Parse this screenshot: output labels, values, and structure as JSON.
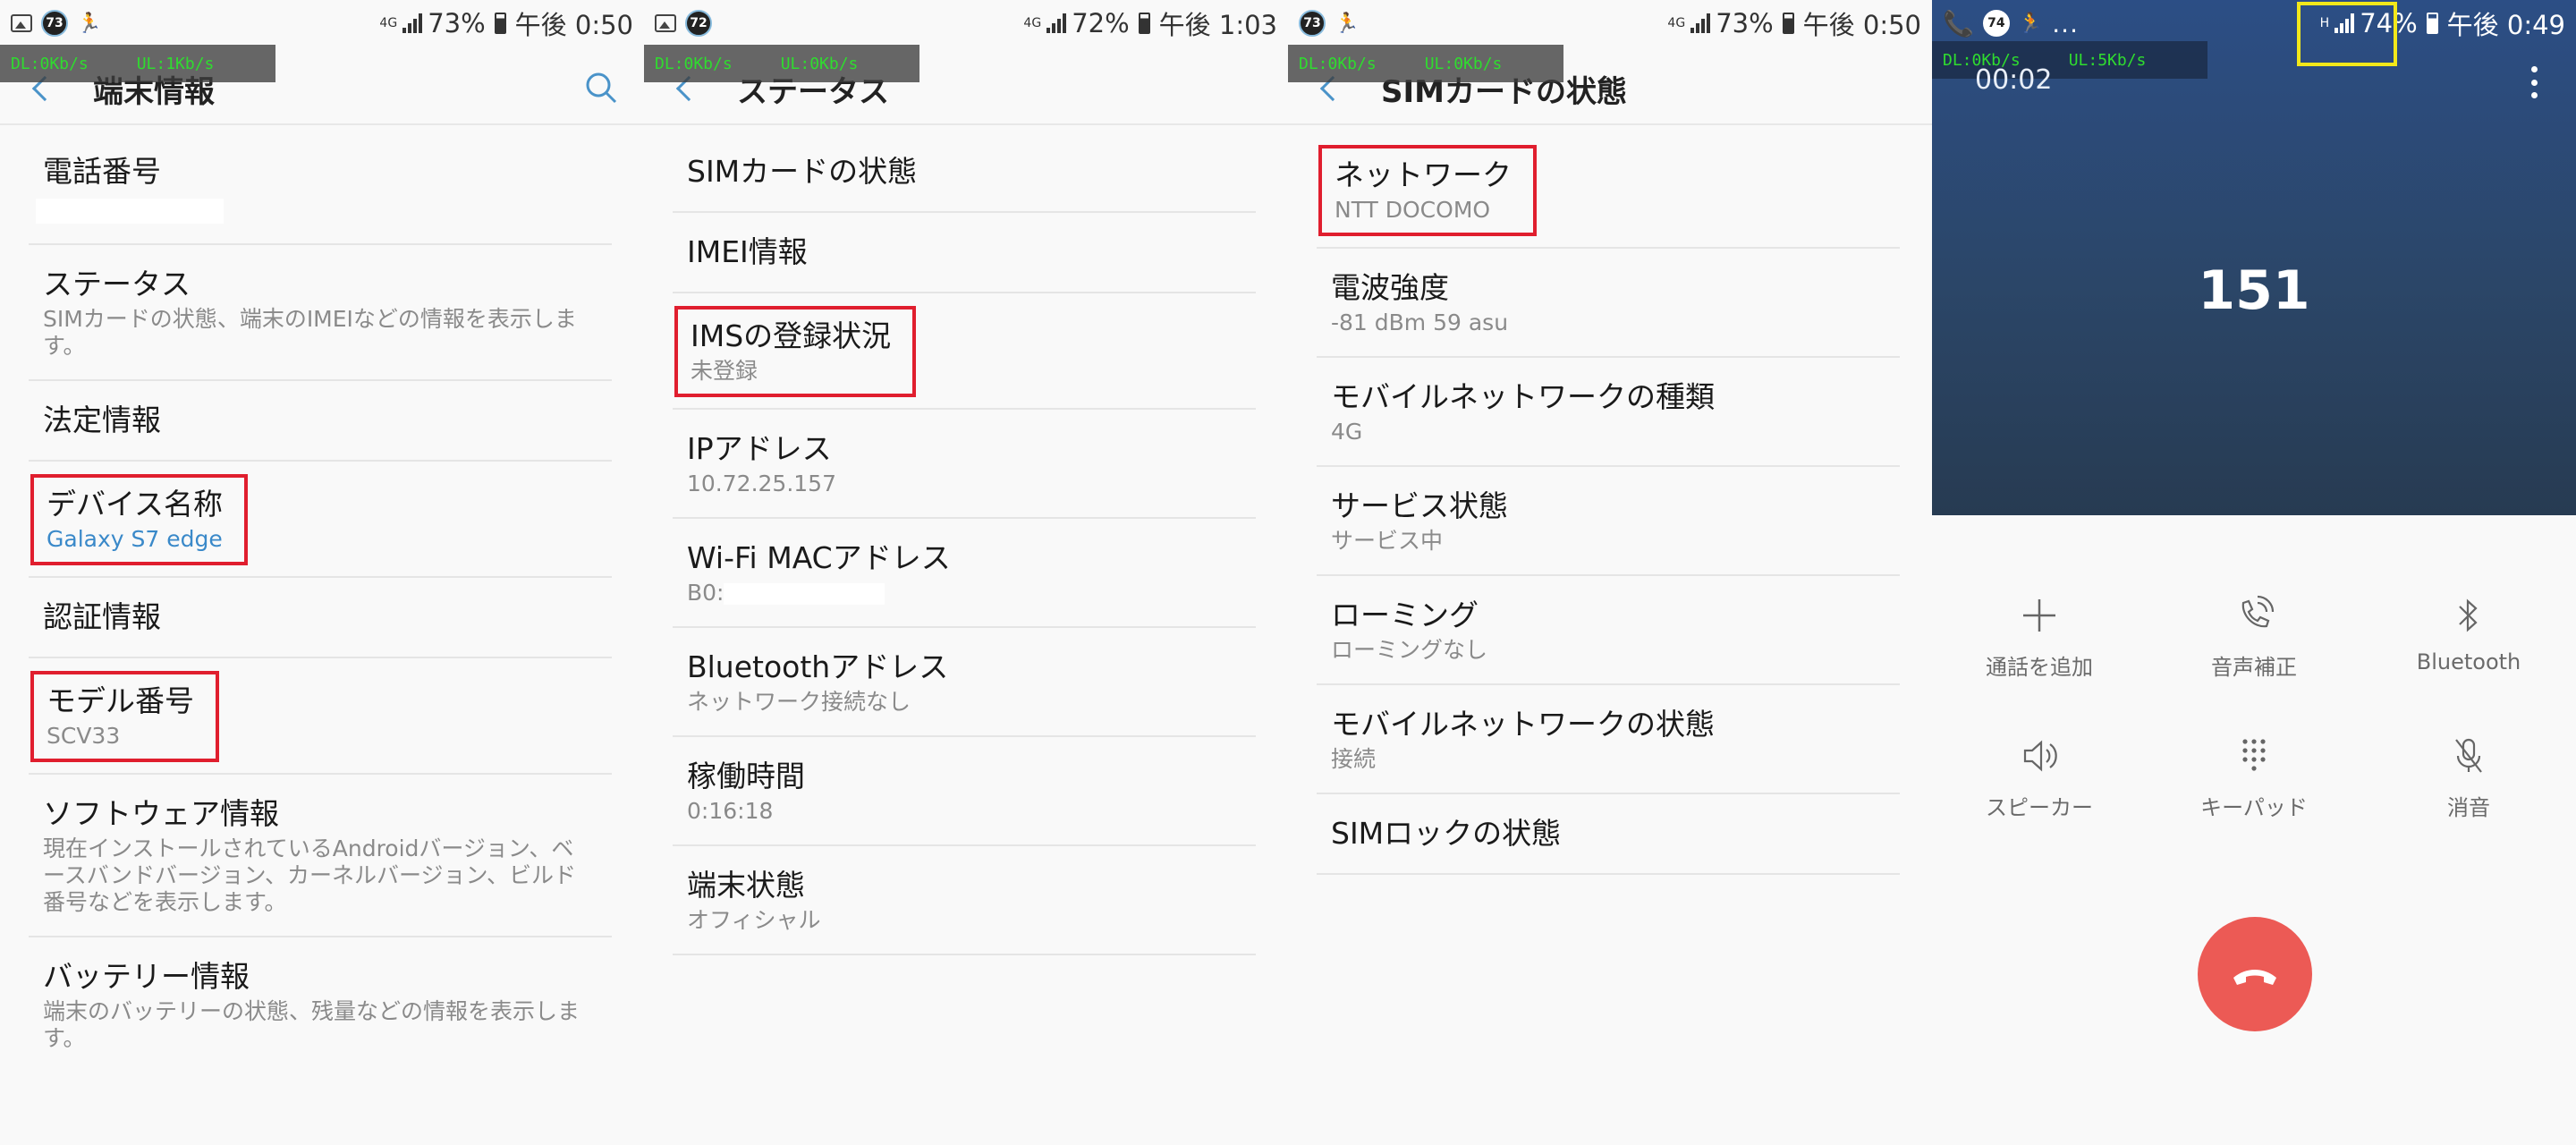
{
  "statusbar": {
    "screen1": {
      "badge": "73",
      "net": "4G",
      "battery": "73%",
      "time": "午後 0:50"
    },
    "screen2": {
      "badge": "72",
      "net": "4G",
      "battery": "72%",
      "time": "午後 1:03"
    },
    "screen3": {
      "badge": "73",
      "net": "4G",
      "battery": "73%",
      "time": "午後 0:50"
    },
    "screen4": {
      "badge": "74",
      "dots": "...",
      "net": "H",
      "battery": "74%",
      "time": "午後 0:49"
    }
  },
  "netmeter": {
    "dl": "DL:0Kb/s",
    "ul": "UL:1Kb/s"
  },
  "netmeter_ul3": "UL:0Kb/s",
  "netmeter_call": {
    "dl": "DL:0Kb/s",
    "ul": "UL:5Kb/s"
  },
  "screen1": {
    "title": "端末情報",
    "items": [
      {
        "label": "電話番号"
      },
      {
        "label": "ステータス",
        "sub": "SIMカードの状態、端末のIMEIなどの情報を表示します。"
      },
      {
        "label": "法定情報"
      },
      {
        "label": "デバイス名称",
        "sub": "Galaxy S7 edge"
      },
      {
        "label": "認証情報"
      },
      {
        "label": "モデル番号",
        "sub": "SCV33"
      },
      {
        "label": "ソフトウェア情報",
        "sub": "現在インストールされているAndroidバージョン、ベースバンドバージョン、カーネルバージョン、ビルド番号などを表示します。"
      },
      {
        "label": "バッテリー情報",
        "sub": "端末のバッテリーの状態、残量などの情報を表示します。"
      }
    ]
  },
  "screen2": {
    "title": "ステータス",
    "items": [
      {
        "label": "SIMカードの状態"
      },
      {
        "label": "IMEI情報"
      },
      {
        "label": "IMSの登録状況",
        "sub": "未登録"
      },
      {
        "label": "IPアドレス",
        "sub": "10.72.25.157"
      },
      {
        "label": "Wi-Fi MACアドレス",
        "sub": "B0:"
      },
      {
        "label": "Bluetoothアドレス",
        "sub": "ネットワーク接続なし"
      },
      {
        "label": "稼働時間",
        "sub": "0:16:18"
      },
      {
        "label": "端末状態",
        "sub": "オフィシャル"
      }
    ]
  },
  "screen3": {
    "title": "SIMカードの状態",
    "items": [
      {
        "label": "ネットワーク",
        "sub": "NTT DOCOMO"
      },
      {
        "label": "電波強度",
        "sub": "-81 dBm 59 asu"
      },
      {
        "label": "モバイルネットワークの種類",
        "sub": "4G"
      },
      {
        "label": "サービス状態",
        "sub": "サービス中"
      },
      {
        "label": "ローミング",
        "sub": "ローミングなし"
      },
      {
        "label": "モバイルネットワークの状態",
        "sub": "接続"
      },
      {
        "label": "SIMロックの状態"
      }
    ]
  },
  "call": {
    "timer": "00:02",
    "number": "151",
    "controls": [
      {
        "label": "通話を追加",
        "icon": "plus-icon"
      },
      {
        "label": "音声補正",
        "icon": "phone-wave-icon"
      },
      {
        "label": "Bluetooth",
        "icon": "bluetooth-icon"
      },
      {
        "label": "スピーカー",
        "icon": "speaker-icon"
      },
      {
        "label": "キーパッド",
        "icon": "keypad-icon"
      },
      {
        "label": "消音",
        "icon": "mute-icon"
      }
    ]
  },
  "colors": {
    "accent": "#3a89c9",
    "highlight": "#e01e2e",
    "call_bg": "#2c4a7a",
    "end_call": "#ec5a55",
    "net_text": "#2fdc2f"
  }
}
